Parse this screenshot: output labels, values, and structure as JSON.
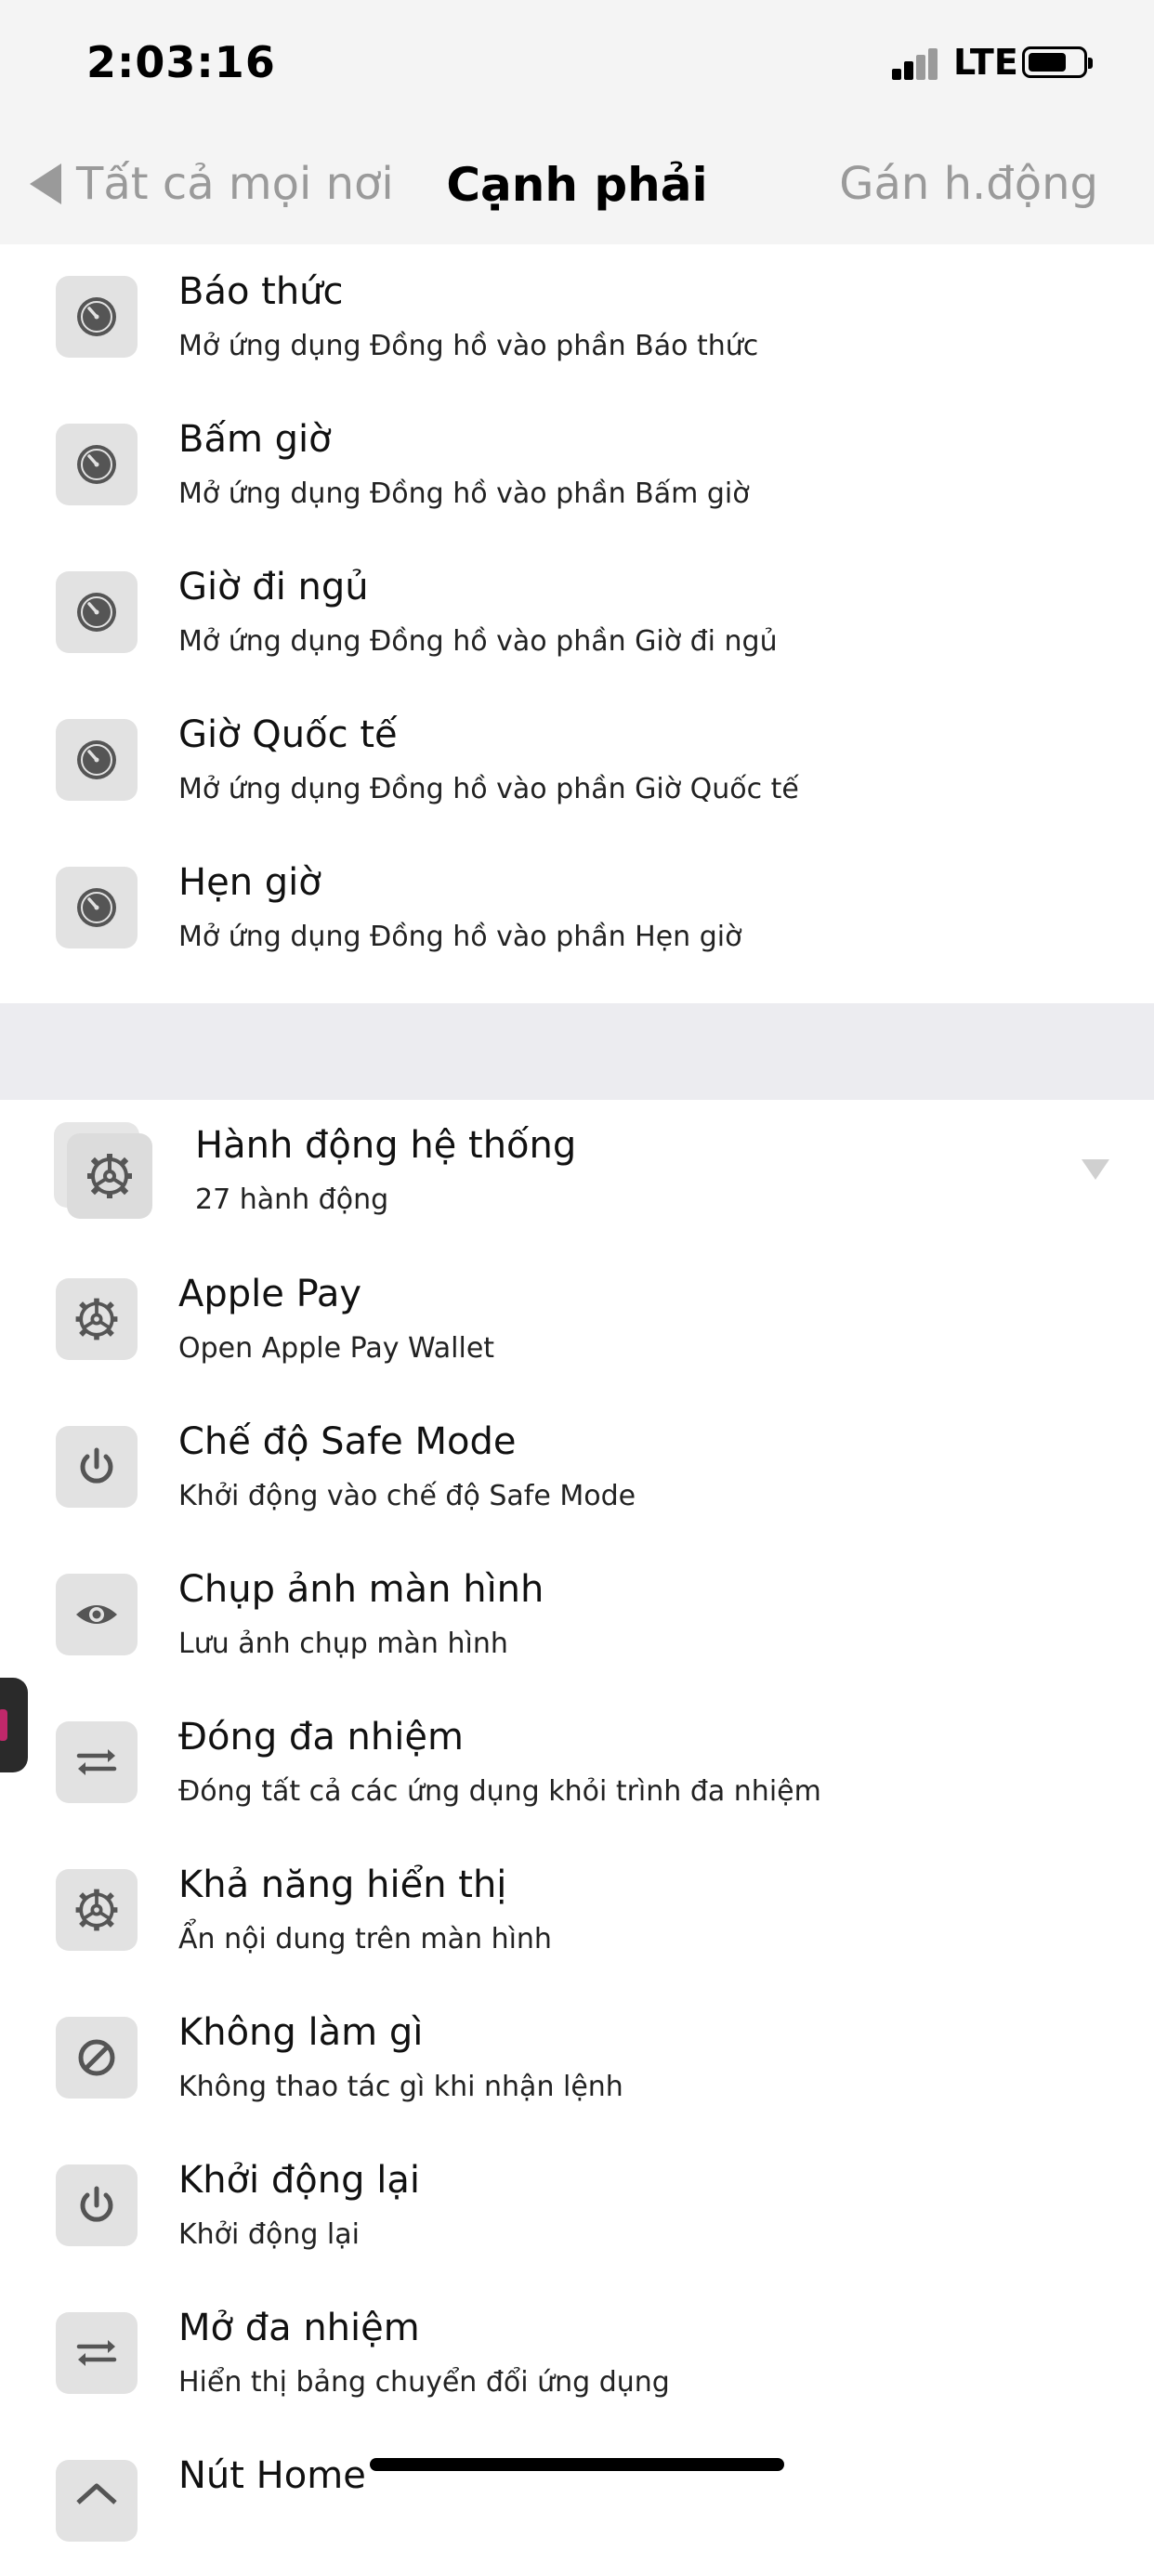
{
  "status": {
    "time": "2:03:16",
    "network": "LTE"
  },
  "nav": {
    "back_label": "Tất cả mọi nơi",
    "title": "Cạnh phải",
    "right_label": "Gán h.động"
  },
  "clock_actions": [
    {
      "title": "Báo thức",
      "subtitle": "Mở ứng dụng Đồng hồ vào phần Báo thức",
      "icon": "clock-icon"
    },
    {
      "title": "Bấm giờ",
      "subtitle": "Mở ứng dụng Đồng hồ vào phần Bấm giờ",
      "icon": "clock-icon"
    },
    {
      "title": "Giờ đi ngủ",
      "subtitle": "Mở ứng dụng Đồng hồ vào phần Giờ đi ngủ",
      "icon": "clock-icon"
    },
    {
      "title": "Giờ Quốc tế",
      "subtitle": "Mở ứng dụng Đồng hồ vào phần Giờ Quốc tế",
      "icon": "clock-icon"
    },
    {
      "title": "Hẹn giờ",
      "subtitle": "Mở ứng dụng Đồng hồ vào phần Hẹn giờ",
      "icon": "clock-icon"
    }
  ],
  "system_group": {
    "title": "Hành động hệ thống",
    "subtitle": "27 hành động",
    "icon": "gear-icon"
  },
  "system_actions": [
    {
      "title": "Apple Pay",
      "subtitle": "Open Apple Pay Wallet",
      "icon": "gear-icon"
    },
    {
      "title": "Chế độ Safe Mode",
      "subtitle": "Khởi động vào chế độ Safe Mode",
      "icon": "power-icon"
    },
    {
      "title": "Chụp ảnh màn hình",
      "subtitle": "Lưu ảnh chụp màn hình",
      "icon": "eye-icon"
    },
    {
      "title": "Đóng đa nhiệm",
      "subtitle": "Đóng tất cả các ứng dụng khỏi trình đa nhiệm",
      "icon": "switch-arrows-icon"
    },
    {
      "title": "Khả năng hiển thị",
      "subtitle": "Ẩn nội dung trên màn hình",
      "icon": "gear-icon"
    },
    {
      "title": "Không làm gì",
      "subtitle": "Không thao tác gì khi nhận lệnh",
      "icon": "prohibited-icon"
    },
    {
      "title": "Khởi động lại",
      "subtitle": "Khởi động lại",
      "icon": "power-icon"
    },
    {
      "title": "Mở đa nhiệm",
      "subtitle": "Hiển thị bảng chuyển đổi ứng dụng",
      "icon": "switch-arrows-icon"
    },
    {
      "title": "Nút Home",
      "subtitle": "",
      "icon": "home-icon"
    }
  ]
}
